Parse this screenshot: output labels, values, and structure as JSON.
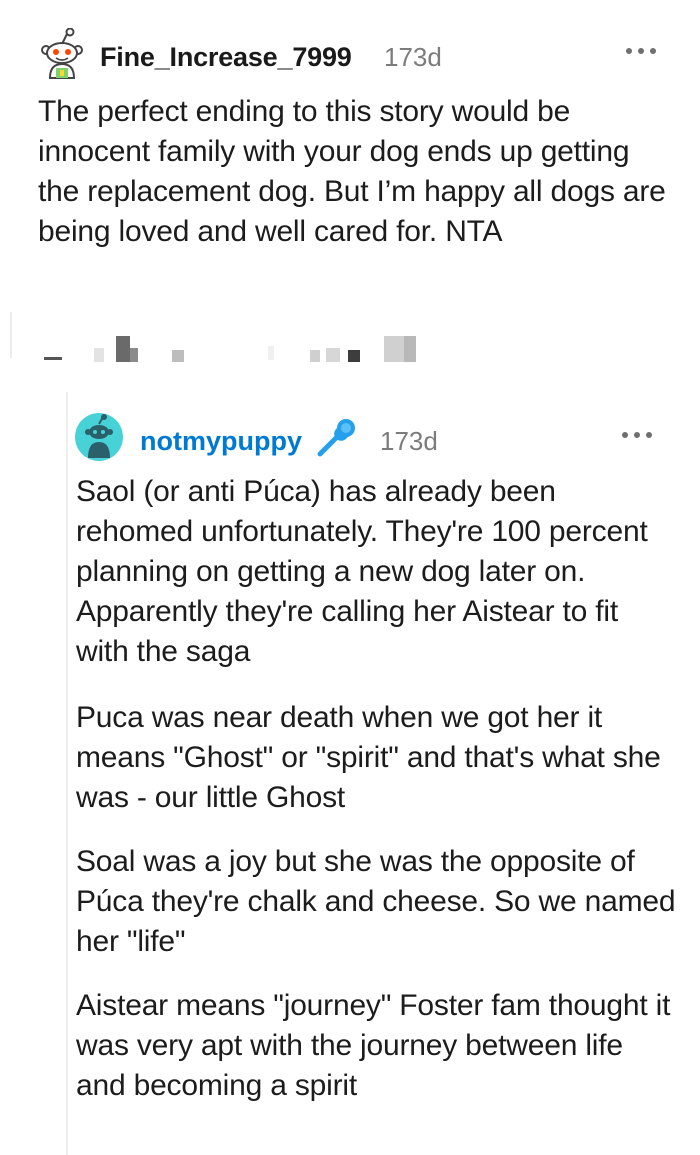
{
  "top_comment": {
    "username": "Fine_Increase_7999",
    "time": "173d",
    "body": "The perfect ending to this story would be innocent family with your dog ends up getting the replacement dog. But I’m happy all dogs are being loved and well cared for. NTA"
  },
  "reply": {
    "username": "notmypuppy",
    "op_badge_icon": "microphone-icon",
    "time": "173d",
    "paragraphs": [
      "Saol (or anti Púca) has already been rehomed unfortunately. They're 100 percent planning on getting a new dog later on. Apparently they're calling her Aistear to fit with the saga",
      "Puca was near death when we got her it means \"Ghost\" or \"spirit\" and that's what she was - our little Ghost",
      "Soal was a joy but she was the opposite of Púca they're chalk and cheese. So we named her \"life\"",
      "Aistear means \"journey\" Foster fam thought it was very apt with the journey between life and becoming a spirit"
    ]
  },
  "colors": {
    "username_link": "#0079d3",
    "mic_badge": "#24a0ed",
    "avatar_teal": "#46d2d6",
    "meta_gray": "#7c7c7c"
  }
}
